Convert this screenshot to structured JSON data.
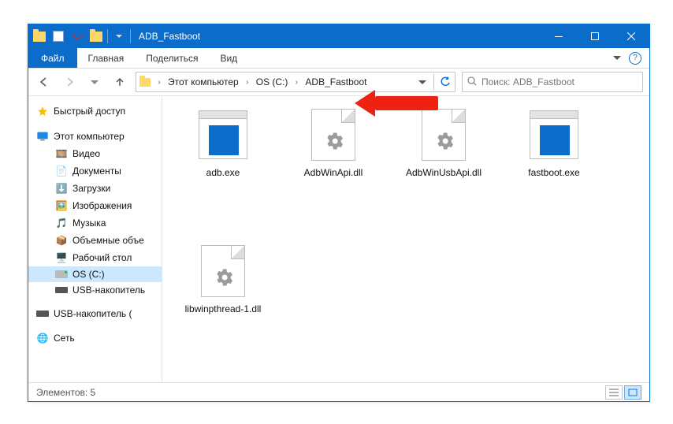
{
  "title": "ADB_Fastboot",
  "ribbon": {
    "file": "Файл",
    "home": "Главная",
    "share": "Поделиться",
    "view": "Вид"
  },
  "breadcrumb": {
    "seg1": "Этот компьютер",
    "seg2": "OS (C:)",
    "seg3": "ADB_Fastboot"
  },
  "search": {
    "placeholder": "Поиск: ADB_Fastboot"
  },
  "sidebar": {
    "quick": "Быстрый доступ",
    "thispc": "Этот компьютер",
    "video": "Видео",
    "docs": "Документы",
    "downloads": "Загрузки",
    "pictures": "Изображения",
    "music": "Музыка",
    "vols": "Объемные объе",
    "desktop": "Рабочий стол",
    "osc": "OS (C:)",
    "usb1": "USB-накопитель",
    "usb2": "USB-накопитель (",
    "network": "Сеть"
  },
  "files": [
    {
      "name": "adb.exe",
      "type": "exe"
    },
    {
      "name": "AdbWinApi.dll",
      "type": "dll"
    },
    {
      "name": "AdbWinUsbApi.dll",
      "type": "dll"
    },
    {
      "name": "fastboot.exe",
      "type": "exe"
    },
    {
      "name": "libwinpthread-1.dll",
      "type": "dll"
    }
  ],
  "status": "Элементов: 5"
}
